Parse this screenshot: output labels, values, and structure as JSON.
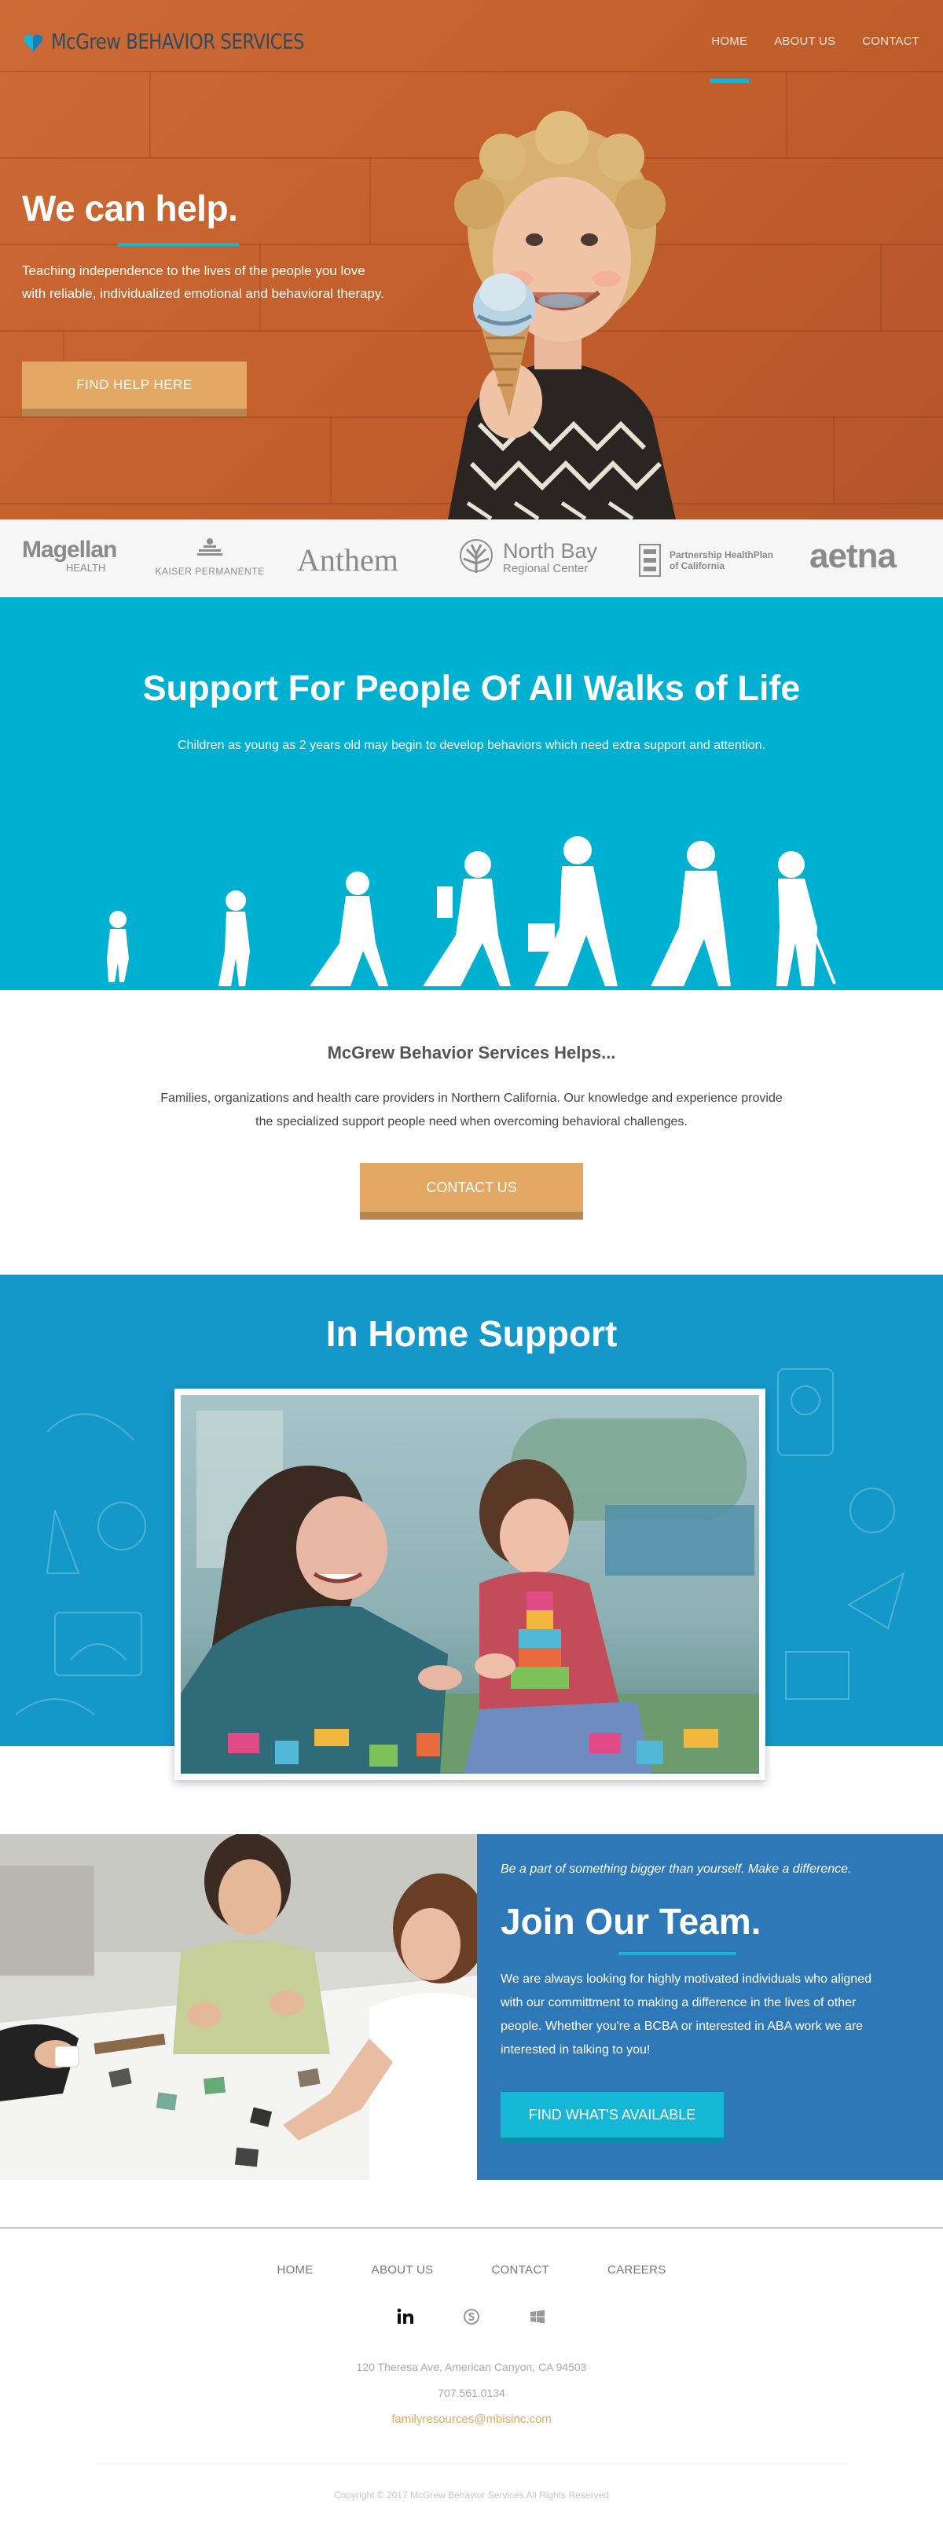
{
  "header": {
    "brand": "McGrew BEHAVIOR SERVICES",
    "nav": [
      {
        "label": "HOME"
      },
      {
        "label": "ABOUT US"
      },
      {
        "label": "CONTACT"
      }
    ]
  },
  "hero": {
    "title": "We can help.",
    "text": "Teaching independence to the lives of the people you love with reliable, individualized emotional and behavioral therapy.",
    "button": "FIND HELP HERE"
  },
  "insurers": {
    "magellan": "Magellan",
    "magellan_sub": "HEALTH",
    "kaiser": "KAISER PERMANENTE",
    "anthem": "Anthem",
    "northbay": "North Bay",
    "northbay_sub": "Regional Center",
    "partnership": "Partnership HealthPlan",
    "partnership_sub": "of California",
    "aetna": "aetna"
  },
  "support": {
    "title": "Support For People Of All Walks of Life",
    "subtitle": "Children as young as 2 years old may begin to develop behaviors which need extra support and attention."
  },
  "helps": {
    "title": "McGrew Behavior Services Helps...",
    "text": "Families, organizations and health care providers in Northern California. Our knowledge and experience provide the specialized support people need when overcoming behavioral challenges.",
    "button": "CONTACT US"
  },
  "inhome": {
    "title": "In Home Support"
  },
  "join": {
    "tagline": "Be a part of something bigger than yourself. Make a difference.",
    "title": "Join Our Team.",
    "text": "We are always looking for highly motivated individuals who aligned with our committment to making a difference in the lives of other people. Whether you're a BCBA or interested in ABA work we are interested in talking to you!",
    "button": "FIND WHAT'S AVAILABLE"
  },
  "footer": {
    "nav": [
      {
        "label": "HOME"
      },
      {
        "label": "ABOUT US"
      },
      {
        "label": "CONTACT"
      },
      {
        "label": "CAREERS"
      }
    ],
    "socials": [
      "linkedin-icon",
      "skype-icon",
      "windows-icon"
    ],
    "address": "120 Theresa Ave, American Canyon, CA 94503",
    "phone": "707.561.0134",
    "email": "familyresources@mbisinc.com",
    "copyright": "Copyright © 2017 McGrew Behavior Services All Rights Reserved"
  },
  "colors": {
    "accent": "#19b3d6",
    "orange_button": "#e2a864",
    "support_bg": "#00b0d1",
    "inhome_bg": "#1497c9",
    "join_bg": "#2f78b8"
  }
}
